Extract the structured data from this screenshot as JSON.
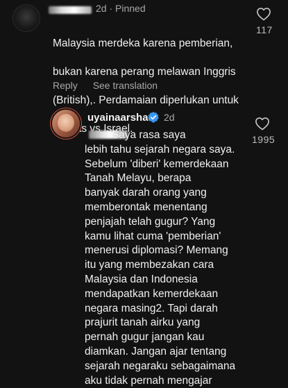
{
  "comment1": {
    "meta": "2d · Pinned",
    "lines": [
      "Malaysia merdeka karena pemberian,",
      "bukan karena perang melawan Inggris",
      "(British),. Perdamaian diperlukan untuk",
      "Hamas vs Israel."
    ],
    "reply_label": "Reply",
    "translate_label": "See translation",
    "like_count": "117"
  },
  "comment2": {
    "username": "uyainaarshad",
    "time": "2d",
    "like_count": "1995",
    "lines": [
      "         Saya rasa saya",
      "lebih tahu sejarah negara saya.",
      "Sebelum 'diberi' kemerdekaan",
      "Tanah Melayu, berapa",
      "banyak darah orang yang",
      "memberontak menentang",
      "penjajah telah gugur? Yang",
      "kamu lihat cuma 'pemberian'",
      "menerusi diplomasi? Memang",
      "itu yang membezakan cara",
      "Malaysia dan Indonesia",
      "mendapatkan kemerdekaan",
      "negara masing2. Tapi darah",
      "prajurit tanah airku yang",
      "pernah gugur jangan kau",
      "diamkan. Jangan ajar tentang",
      "sejarah negaraku sebagaimana",
      "aku tidak pernah mengajar"
    ]
  },
  "icons": {
    "like": "heart-outline-icon",
    "verified": "verified-badge-icon",
    "verified_color": "#3897f0"
  }
}
